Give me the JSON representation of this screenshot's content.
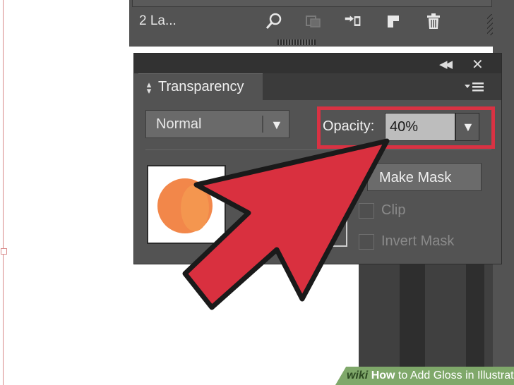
{
  "layers_panel": {
    "count_label": "2 La..."
  },
  "transparency_panel": {
    "tab_label": "Transparency",
    "blend_mode": "Normal",
    "opacity_label": "Opacity:",
    "opacity_value": "40%",
    "make_mask_label": "Make Mask",
    "clip_label": "Clip",
    "invert_mask_label": "Invert Mask"
  },
  "footer": {
    "logo": "wiki",
    "how_to": "How",
    "title": "to Add Gloss in Illustrator"
  },
  "colors": {
    "panel_bg": "#535353",
    "highlight_red": "#d93243",
    "thumbnail_fill": "#f2874a"
  }
}
